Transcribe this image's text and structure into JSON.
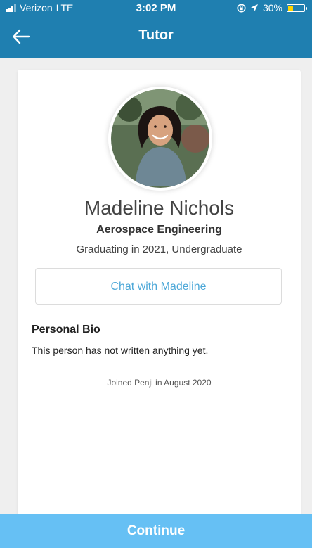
{
  "status_bar": {
    "carrier": "Verizon",
    "network": "LTE",
    "time": "3:02 PM",
    "battery_percent": "30%",
    "battery_level": 0.3,
    "icons": [
      "signal-icon",
      "screen-rotation-lock-icon",
      "location-icon",
      "battery-icon"
    ]
  },
  "nav": {
    "title": "Tutor",
    "back_icon": "back-arrow-icon"
  },
  "profile": {
    "name": "Madeline Nichols",
    "major": "Aerospace Engineering",
    "graduation": "Graduating in 2021, Undergraduate",
    "chat_label": "Chat with Madeline",
    "bio_heading": "Personal Bio",
    "bio_text": "This person has not written anything yet.",
    "joined": "Joined Penji in August 2020"
  },
  "footer": {
    "continue_label": "Continue"
  },
  "colors": {
    "header": "#1f7fb0",
    "accent": "#4da8d8",
    "continue": "#66c0f4",
    "background": "#efefef",
    "battery": "#ffd400"
  }
}
